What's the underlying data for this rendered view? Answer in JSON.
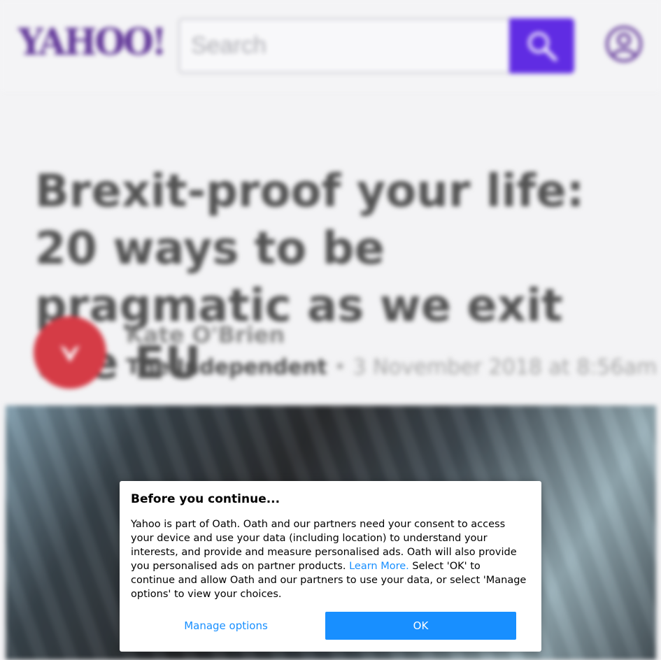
{
  "header": {
    "logo_text": "YAHOO!",
    "search_placeholder": "Search",
    "brand_color": "#4b1a8a",
    "search_button_color": "#4b0fe0"
  },
  "article": {
    "headline": "Brexit-proof your life: 20 ways to be pragmatic as we exit the EU",
    "author": "Kate O'Brien",
    "source": "The Independent",
    "timestamp": "• 3 November 2018 at 8:56am"
  },
  "dialog": {
    "title": "Before you continue...",
    "body_part1": "Yahoo is part of Oath. Oath and our partners need your consent to access your device and use your data (including location) to understand your interests, and provide and measure personalised ads. Oath will also provide you personalised ads on partner products. ",
    "learn_more": "Learn More.",
    "body_part2": " Select 'OK' to continue and allow Oath and our partners to use your data, or select 'Manage options' to view your choices.",
    "manage_label": "Manage options",
    "ok_label": "OK",
    "accent_color": "#188fff"
  }
}
